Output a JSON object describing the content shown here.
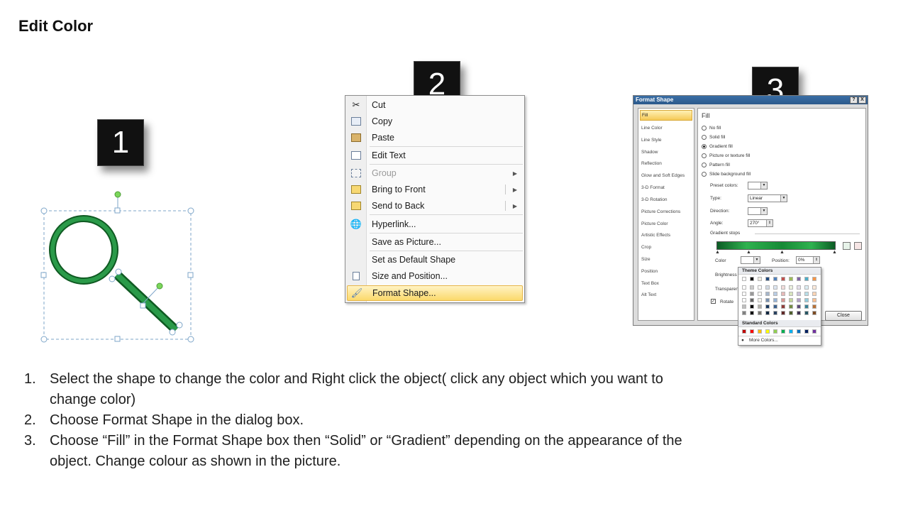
{
  "title": "Edit Color",
  "steps": [
    "1",
    "2",
    "3"
  ],
  "context_menu": {
    "items": [
      {
        "label": "Cut",
        "icon": "scissors-icon"
      },
      {
        "label": "Copy",
        "icon": "copy-icon"
      },
      {
        "label": "Paste",
        "icon": "paste-icon"
      },
      {
        "label": "Edit Text",
        "icon": "edit-text-icon"
      },
      {
        "label": "Group",
        "icon": "group-icon",
        "disabled": true
      },
      {
        "label": "Bring to Front",
        "icon": "bring-front-icon"
      },
      {
        "label": "Send to Back",
        "icon": "send-back-icon"
      },
      {
        "label": "Hyperlink...",
        "icon": "hyperlink-icon"
      },
      {
        "label": "Save as Picture...",
        "icon": ""
      },
      {
        "label": "Set as Default Shape",
        "icon": ""
      },
      {
        "label": "Size and Position...",
        "icon": "size-position-icon"
      },
      {
        "label": "Format Shape...",
        "icon": "format-shape-icon"
      }
    ]
  },
  "dialog": {
    "title": "Format Shape",
    "title_buttons": [
      "?",
      "X"
    ],
    "nav": [
      "Fill",
      "Line Color",
      "Line Style",
      "Shadow",
      "Reflection",
      "Glow and Soft Edges",
      "3-D Format",
      "3-D Rotation",
      "Picture Corrections",
      "Picture Color",
      "Artistic Effects",
      "Crop",
      "Size",
      "Position",
      "Text Box",
      "Alt Text"
    ],
    "section": "Fill",
    "fill_options": [
      "No fill",
      "Solid fill",
      "Gradient fill",
      "Picture or texture fill",
      "Pattern fill",
      "Slide background fill"
    ],
    "selected_fill": "Gradient fill",
    "labels": {
      "preset": "Preset colors:",
      "type": "Type:",
      "type_value": "Linear",
      "direction": "Direction:",
      "angle": "Angle:",
      "angle_value": "270°",
      "stops": "Gradient stops",
      "color": "Color",
      "position": "Position:",
      "position_value": "0%",
      "brightness": "Brightness",
      "transparency": "Transparen",
      "rotate": "Rotate"
    },
    "close_label": "Close"
  },
  "color_popup": {
    "theme_label": "Theme Colors",
    "standard_label": "Standard Colors",
    "more_label": "More Colors...",
    "theme_top": [
      "#ffffff",
      "#000000",
      "#eeece1",
      "#1f497d",
      "#4f81bd",
      "#c0504d",
      "#9bbb59",
      "#8064a2",
      "#4bacc6",
      "#f79646"
    ],
    "standard": [
      "#c00000",
      "#ff0000",
      "#ffc000",
      "#ffff00",
      "#92d050",
      "#00b050",
      "#00b0f0",
      "#0070c0",
      "#002060",
      "#7030a0"
    ]
  },
  "instructions": [
    "Select the shape to change the color and Right click the object( click any object which you want to change color)",
    "Choose Format Shape in the dialog box.",
    "Choose “Fill” in the Format Shape box then “Solid” or “Gradient” depending on the appearance of the object. Change colour as shown in the picture."
  ],
  "instruction_numbers": [
    "1.",
    "2.",
    "3."
  ],
  "colors": {
    "shape_green": "#1e8a3c",
    "badge": "#111111",
    "highlight": "#fbd96b"
  }
}
